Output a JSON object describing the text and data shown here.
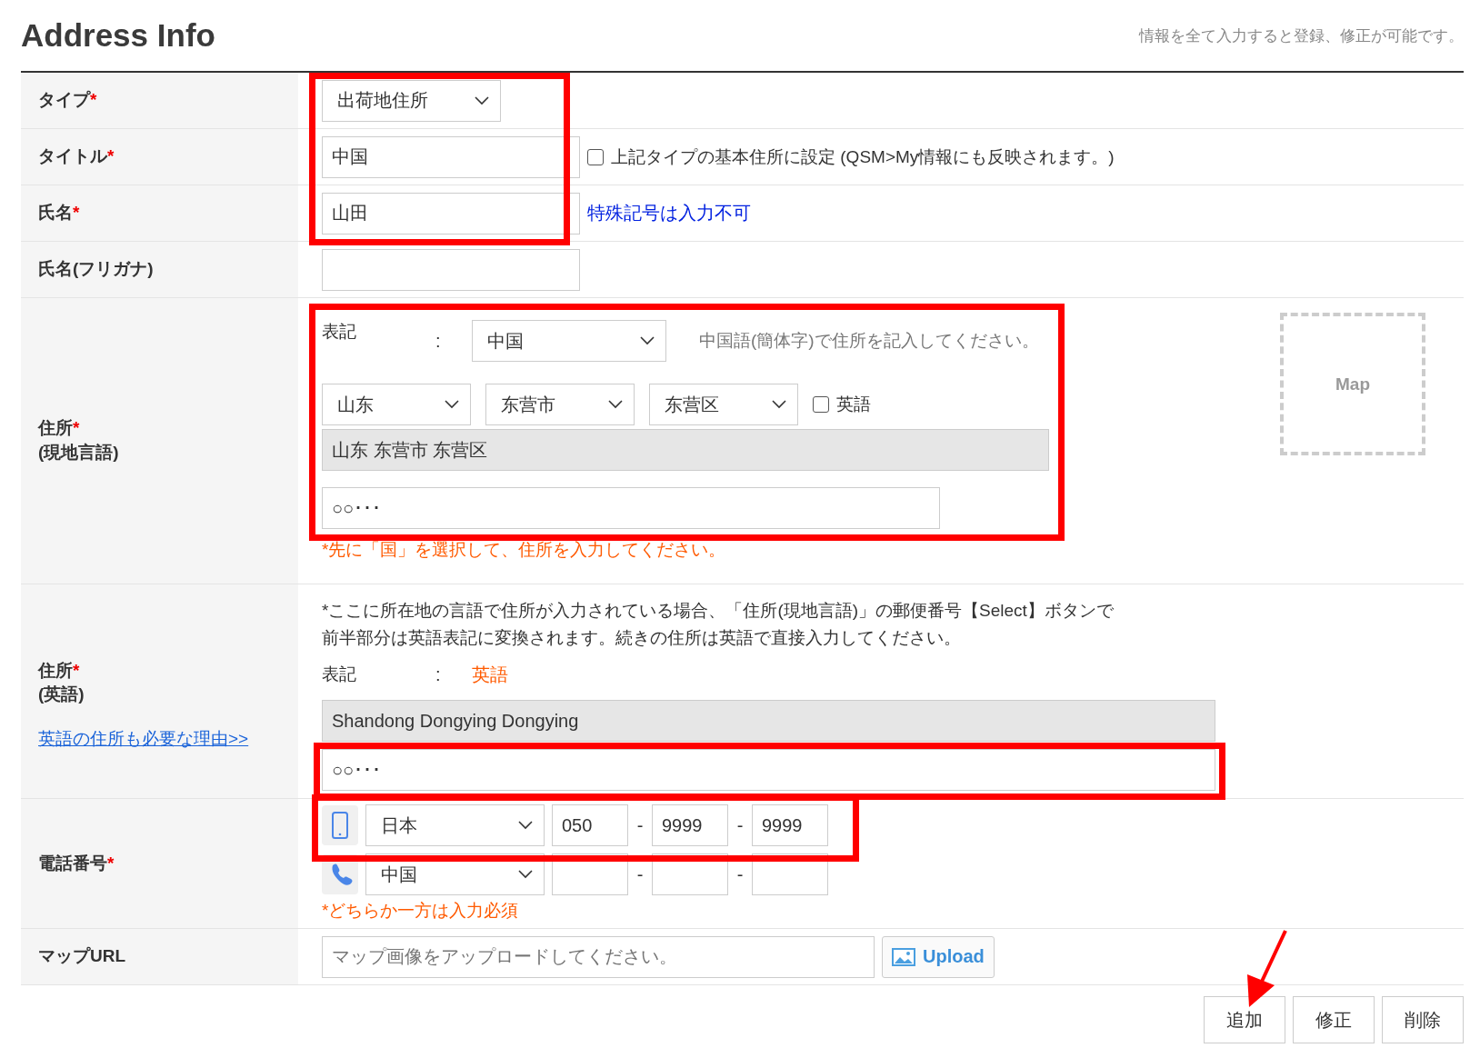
{
  "header": {
    "title": "Address Info",
    "note": "情報を全て入力すると登録、修正が可能です。"
  },
  "type_row": {
    "label": "タイプ",
    "required_mark": "*",
    "value": "出荷地住所"
  },
  "title_row": {
    "label": "タイトル",
    "required_mark": "*",
    "value": "中国",
    "checkbox": {
      "label": "上記タイプの基本住所に設定 (QSM>My情報にも反映されます。)",
      "checked": false
    }
  },
  "name_row": {
    "label": "氏名",
    "required_mark": "*",
    "value": "山田",
    "hint": "特殊記号は入力不可"
  },
  "kana_row": {
    "label": "氏名(フリガナ)"
  },
  "local_address": {
    "label": "住所",
    "sublabel": "(現地言語)",
    "required_mark": "*",
    "notation_label": "表記",
    "colon": ":",
    "country": "中国",
    "note": "中国語(簡体字)で住所を記入してください。",
    "regions": [
      "山东",
      "东营市",
      "东营区"
    ],
    "english": {
      "label": "英語",
      "checked": false
    },
    "resolved": "山东 东营市 东营区",
    "detail": "○○･･･",
    "warning": "*先に「国」を選択して、住所を入力してください。",
    "map_button": "Map"
  },
  "english_address": {
    "label": "住所",
    "sublabel": "(英語)",
    "required_mark": "*",
    "link": "英語の住所も必要な理由>>",
    "note_lines": [
      "*ここに所在地の言語で住所が入力されている場合、「住所(現地言語)」の郵便番号【Select】ボタンで",
      "前半部分は英語表記に変換されます。続きの住所は英語で直接入力してください。"
    ],
    "notation_label": "表記",
    "colon": ":",
    "notation_value": "英語",
    "resolved": "Shandong Dongying Dongying",
    "detail": "○○･･･"
  },
  "phone_row": {
    "label": "電話番号",
    "required_mark": "*",
    "lines": [
      {
        "kind": "mobile",
        "country": "日本",
        "parts": [
          "050",
          "9999",
          "9999"
        ],
        "separators": [
          "-",
          "-"
        ]
      },
      {
        "kind": "landline",
        "country": "中国",
        "separators": [
          "-",
          "-"
        ]
      }
    ],
    "warning": "*どちらか一方は入力必須"
  },
  "map_row": {
    "label": "マップURL",
    "placeholder": "マップ画像をアップロードしてください。",
    "upload": "Upload"
  },
  "buttons": [
    "追加",
    "修正",
    "削除"
  ]
}
